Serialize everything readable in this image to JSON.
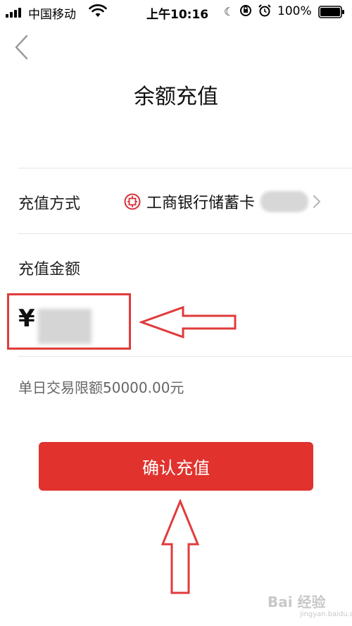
{
  "status_bar": {
    "carrier": "中国移动",
    "time": "上午10:16",
    "battery_percent": "100%"
  },
  "nav": {
    "title": "余额充值"
  },
  "method_row": {
    "label": "充值方式",
    "bank_name": "工商银行储蓄卡"
  },
  "amount_row": {
    "label": "充值金额",
    "currency_symbol": "¥"
  },
  "limit_text": "单日交易限额50000.00元",
  "confirm_button": {
    "label": "确认充值"
  },
  "watermark": {
    "text": "Bai 经验",
    "url": "jingyan.baidu.com"
  },
  "colors": {
    "accent": "#e1322d",
    "annotation": "#e03b3b",
    "bank_logo": "#d6313a"
  }
}
